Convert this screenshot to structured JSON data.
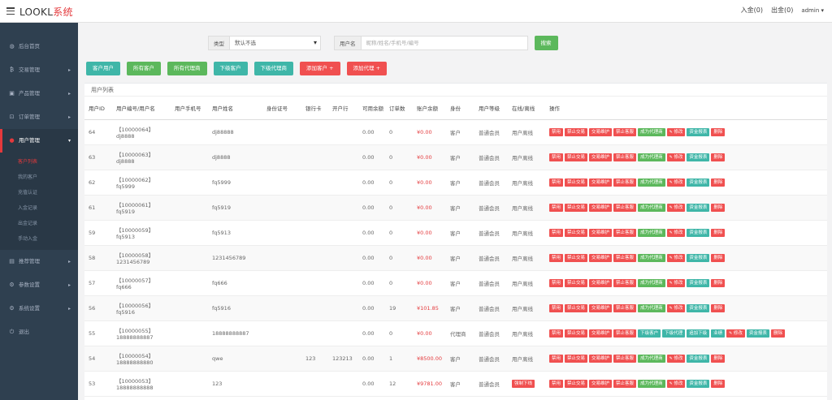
{
  "header": {
    "logo_main": "LOOKL",
    "logo_sub": "系统",
    "deposit_label": "入金(0)",
    "withdraw_label": "出金(0)",
    "admin_label": "admin ▾"
  },
  "sidebar": {
    "items": [
      {
        "icon": "dashboard-icon",
        "glyph": "◍",
        "label": "后台首页"
      },
      {
        "icon": "bitcoin-icon",
        "glyph": "₿",
        "label": "交易管理"
      },
      {
        "icon": "product-icon",
        "glyph": "▣",
        "label": "产品管理"
      },
      {
        "icon": "cart-icon",
        "glyph": "⊡",
        "label": "订单管理"
      },
      {
        "icon": "user-icon",
        "glyph": "●",
        "label": "用户管理"
      },
      {
        "icon": "chart-icon",
        "glyph": "▤",
        "label": "推荐管理"
      },
      {
        "icon": "gears-icon",
        "glyph": "⚙",
        "label": "参数设置"
      },
      {
        "icon": "gear-icon",
        "glyph": "⚙",
        "label": "系统设置"
      },
      {
        "icon": "logout-icon",
        "glyph": "⏻",
        "label": "退出"
      }
    ],
    "sub_items": [
      "客户列表",
      "我的客户",
      "充值认证",
      "入金记录",
      "出金记录",
      "手动入金"
    ]
  },
  "search": {
    "type_label": "类型",
    "type_value": "默认不选",
    "user_label": "用户名",
    "user_placeholder": "昵称/姓名/手机号/编号",
    "button": "搜索"
  },
  "filters": [
    "客户用户",
    "所有客户",
    "所有代理商",
    "下级客户",
    "下级代理商",
    "添加客户 +",
    "添加代理 +"
  ],
  "panel": {
    "title": "用户列表"
  },
  "table": {
    "headers": [
      "用户ID",
      "用户编号/用户名",
      "用户手机号",
      "用户姓名",
      "身份证号",
      "银行卡",
      "开户行",
      "可用余额",
      "订单数",
      "账户余额",
      "身份",
      "用户等级",
      "在线/离线",
      "操作"
    ],
    "rows": [
      {
        "id": "64",
        "code": "【10000064】",
        "name": "dj8888",
        "phone": "",
        "realname": "dj88888",
        "idcard": "",
        "bank": "",
        "bankbranch": "",
        "avail": "0.00",
        "orders": "0",
        "balance": "¥0.00",
        "role": "客户",
        "level": "普通会员",
        "status": "用户离线"
      },
      {
        "id": "63",
        "code": "【10000063】",
        "name": "dj8888",
        "phone": "",
        "realname": "dj8888",
        "idcard": "",
        "bank": "",
        "bankbranch": "",
        "avail": "0.00",
        "orders": "0",
        "balance": "¥0.00",
        "role": "客户",
        "level": "普通会员",
        "status": "用户离线"
      },
      {
        "id": "62",
        "code": "【10000062】",
        "name": "fq5999",
        "phone": "",
        "realname": "fq5999",
        "idcard": "",
        "bank": "",
        "bankbranch": "",
        "avail": "0.00",
        "orders": "0",
        "balance": "¥0.00",
        "role": "客户",
        "level": "普通会员",
        "status": "用户离线"
      },
      {
        "id": "61",
        "code": "【10000061】",
        "name": "fq5919",
        "phone": "",
        "realname": "fq5919",
        "idcard": "",
        "bank": "",
        "bankbranch": "",
        "avail": "0.00",
        "orders": "0",
        "balance": "¥0.00",
        "role": "客户",
        "level": "普通会员",
        "status": "用户离线"
      },
      {
        "id": "59",
        "code": "【10000059】",
        "name": "fq5913",
        "phone": "",
        "realname": "fq5913",
        "idcard": "",
        "bank": "",
        "bankbranch": "",
        "avail": "0.00",
        "orders": "0",
        "balance": "¥0.00",
        "role": "客户",
        "level": "普通会员",
        "status": "用户离线"
      },
      {
        "id": "58",
        "code": "【10000058】",
        "name": "1231456789",
        "phone": "",
        "realname": "1231456789",
        "idcard": "",
        "bank": "",
        "bankbranch": "",
        "avail": "0.00",
        "orders": "0",
        "balance": "¥0.00",
        "role": "客户",
        "level": "普通会员",
        "status": "用户离线"
      },
      {
        "id": "57",
        "code": "【10000057】",
        "name": "fq666",
        "phone": "",
        "realname": "fq666",
        "idcard": "",
        "bank": "",
        "bankbranch": "",
        "avail": "0.00",
        "orders": "0",
        "balance": "¥0.00",
        "role": "客户",
        "level": "普通会员",
        "status": "用户离线"
      },
      {
        "id": "56",
        "code": "【10000056】",
        "name": "fq5916",
        "phone": "",
        "realname": "fq5916",
        "idcard": "",
        "bank": "",
        "bankbranch": "",
        "avail": "0.00",
        "orders": "19",
        "balance": "¥101.85",
        "role": "客户",
        "level": "普通会员",
        "status": "用户离线"
      },
      {
        "id": "55",
        "code": "【10000055】",
        "name": "18888888887",
        "phone": "",
        "realname": "18888888887",
        "idcard": "",
        "bank": "",
        "bankbranch": "",
        "avail": "0.00",
        "orders": "0",
        "balance": "¥0.00",
        "role": "代理商",
        "level": "普通会员",
        "status": "用户离线"
      },
      {
        "id": "54",
        "code": "【10000054】",
        "name": "18888888880",
        "phone": "",
        "realname": "qwe",
        "idcard": "",
        "bank": "123",
        "bankbranch": "123213",
        "avail": "0.00",
        "orders": "1",
        "balance": "¥8500.00",
        "role": "客户",
        "level": "普通会员",
        "status": "用户离线"
      },
      {
        "id": "53",
        "code": "【10000053】",
        "name": "18888888888",
        "phone": "",
        "realname": "123",
        "idcard": "",
        "bank": "",
        "bankbranch": "",
        "avail": "0.00",
        "orders": "12",
        "balance": "¥9781.00",
        "role": "客户",
        "level": "普通会员",
        "status": "强制下线"
      }
    ],
    "ops_client": [
      "禁用",
      "禁止交易",
      "交易维护",
      "禁止客服",
      "成为代理商",
      "修改",
      "资金报表",
      "删除"
    ],
    "ops_agent": [
      "禁用",
      "禁止交易",
      "交易维护",
      "禁止客服",
      "下级客户",
      "下级代理",
      "追加下级",
      "业绩",
      "修改",
      "资金报表",
      "删除"
    ]
  },
  "colors": {
    "sidebar_bg": "#2f4050",
    "accent_red": "#e4393c",
    "btn_green": "#5cb85c",
    "btn_teal": "#3fb6a8"
  }
}
